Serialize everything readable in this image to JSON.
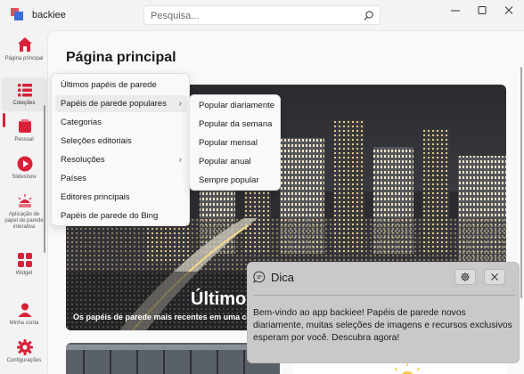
{
  "app": {
    "title": "backiee"
  },
  "search": {
    "placeholder": "Pesquisa..."
  },
  "sidebar": {
    "items": [
      {
        "label": "Página principal",
        "icon": "home-icon"
      },
      {
        "label": "Coleções",
        "icon": "collections-icon"
      },
      {
        "label": "Pessoal",
        "icon": "personal-icon"
      },
      {
        "label": "Slideshow",
        "icon": "slideshow-icon"
      },
      {
        "label": "Aplicação de papel de parede interativa",
        "icon": "interactive-wallpaper-icon"
      },
      {
        "label": "Widget",
        "icon": "widget-icon"
      },
      {
        "label": "Minha conta",
        "icon": "account-icon"
      },
      {
        "label": "Configurações",
        "icon": "settings-icon"
      }
    ]
  },
  "main": {
    "title": "Página principal",
    "hero_title": "Últimos",
    "hero_subtitle": "Os papéis de parede mais recentes em uma co"
  },
  "collections_menu": {
    "items": [
      {
        "label": "Últimos papéis de parede",
        "submenu": false
      },
      {
        "label": "Papéis de parede populares",
        "submenu": true
      },
      {
        "label": "Categorias",
        "submenu": false
      },
      {
        "label": "Seleções editoriais",
        "submenu": false
      },
      {
        "label": "Resoluções",
        "submenu": true
      },
      {
        "label": "Países",
        "submenu": false
      },
      {
        "label": "Editores principais",
        "submenu": false
      },
      {
        "label": "Papéis de parede do Bing",
        "submenu": false
      }
    ],
    "highlighted_index": 1
  },
  "popular_submenu": {
    "items": [
      "Popular diariamente",
      "Popular da semana",
      "Popular mensal",
      "Popular anual",
      "Sempre popular"
    ]
  },
  "tip": {
    "title": "Dica",
    "text": "Bem-vindo ao app backiee! Papéis de parede novos diariamente, muitas seleções de imagens e recursos exclusivos esperam por você. Descubra agora!"
  },
  "colors": {
    "accent": "#d9213a",
    "tip_background": "#c9c9c9"
  }
}
